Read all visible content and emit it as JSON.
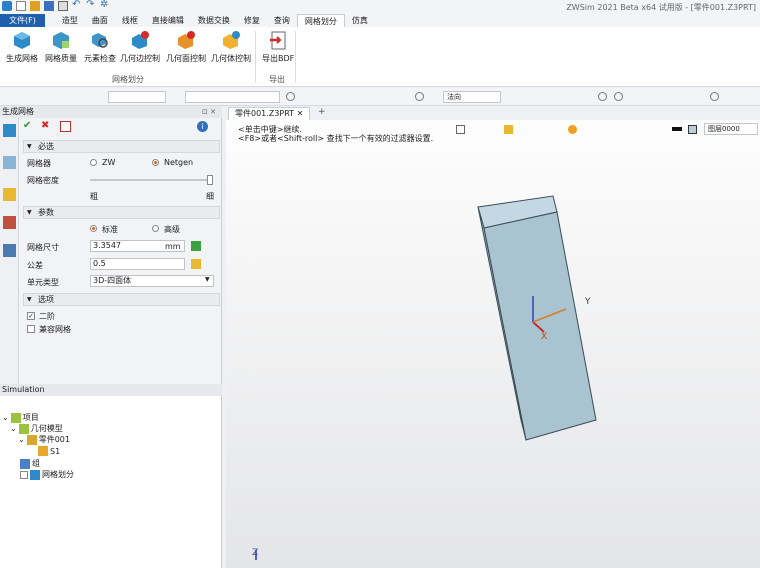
{
  "window": {
    "title": "ZWSim 2021 Beta x64 试用版 - [零件001.Z3PRT]"
  },
  "menu": {
    "file": "文件(F)",
    "tabs": [
      "造型",
      "曲面",
      "线框",
      "直接编辑",
      "数据交换",
      "修复",
      "查询",
      "网格划分",
      "仿真"
    ]
  },
  "ribbon": {
    "buttons": [
      "生成网格",
      "网格质量",
      "元素检查",
      "几何边控制",
      "几何面控制",
      "几何体控制",
      "导出BDF"
    ],
    "groups": [
      "网格划分",
      "导出"
    ]
  },
  "toolbar": {
    "direction_field": "法向",
    "filter_label": "图层0000"
  },
  "panel": {
    "title": "生成网格",
    "sections": {
      "required": "必选",
      "params": "参数",
      "options": "选项"
    },
    "mesher_label": "网格器",
    "mesher_zw": "ZW",
    "mesher_netgen": "Netgen",
    "density_label": "网格密度",
    "density_coarse": "粗",
    "density_fine": "细",
    "mode_standard": "标准",
    "mode_advanced": "高级",
    "size_label": "网格尺寸",
    "size_value": "3.3547",
    "size_unit": "mm",
    "tol_label": "公差",
    "tol_value": "0.5",
    "elem_label": "单元类型",
    "elem_value": "3D-四面体",
    "opt_second": "二阶",
    "opt_compat": "兼容网格"
  },
  "simulation": {
    "title": "Simulation",
    "tree": [
      "项目",
      "几何模型",
      "零件001",
      "S1",
      "组",
      "网格划分"
    ]
  },
  "document": {
    "tab": "零件001.Z3PRT",
    "add": "+"
  },
  "viewport": {
    "msg1": "<单击中键>继续.",
    "msg2": "<F8>或者<Shift-roll> 查找下一个有效的过滤器设置.",
    "axis_y": "Y",
    "axis_x": "X",
    "axis_z": "Z"
  },
  "colors": {
    "accent": "#1f5fae",
    "block": "#a9c3d0"
  }
}
